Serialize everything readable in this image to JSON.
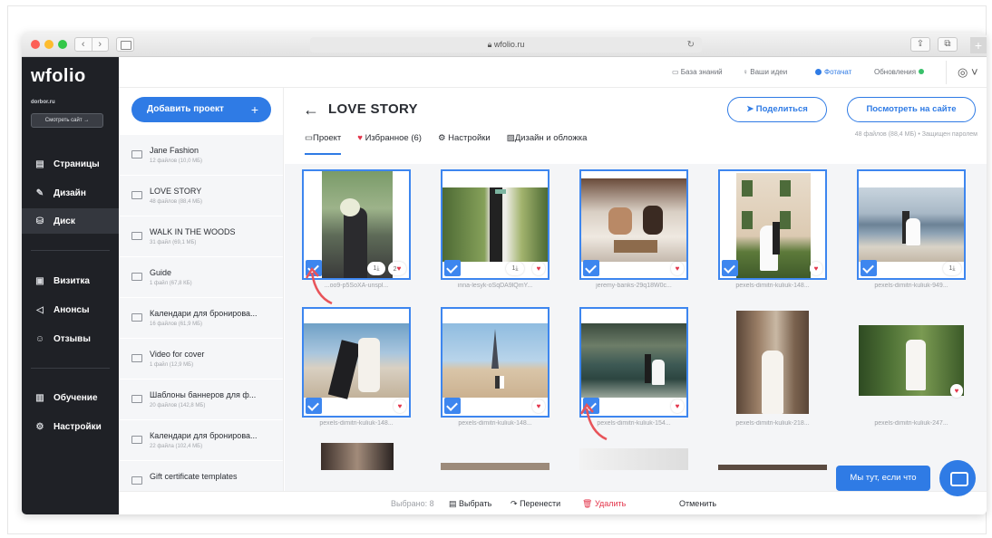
{
  "browser": {
    "url": "wfolio.ru",
    "lock_icon": "lock-icon"
  },
  "sidebar": {
    "logo": "wfolio",
    "domain": "dorbor.ru",
    "view_site": "Смотреть сайт →",
    "items": [
      {
        "label": "Страницы",
        "icon": "pages-icon"
      },
      {
        "label": "Дизайн",
        "icon": "brush-icon"
      },
      {
        "label": "Диск",
        "icon": "disk-icon"
      },
      {
        "label": "Визитка",
        "icon": "card-icon"
      },
      {
        "label": "Анонсы",
        "icon": "megaphone-icon"
      },
      {
        "label": "Отзывы",
        "icon": "reviews-icon"
      },
      {
        "label": "Обучение",
        "icon": "book-icon"
      },
      {
        "label": "Настройки",
        "icon": "gear-icon"
      }
    ]
  },
  "header": {
    "knowledge": "База знаний",
    "ideas": "Ваши идеи",
    "photochat": "Фотачат",
    "updates": "Обновления"
  },
  "projects": {
    "add_label": "Добавить проект",
    "add_plus": "+",
    "list": [
      {
        "name": "Jane Fashion",
        "meta": "12 файлов (10,0 МБ)"
      },
      {
        "name": "LOVE STORY",
        "meta": "48 файлов (88,4 МБ)"
      },
      {
        "name": "WALK IN THE WOODS",
        "meta": "31 файл (69,1 МБ)"
      },
      {
        "name": "Guide",
        "meta": "1 файл (67,8 КБ)"
      },
      {
        "name": "Календари для бронирова...",
        "meta": "16 файлов (61,9 МБ)"
      },
      {
        "name": "Video for cover",
        "meta": "1 файл (12,9 МБ)"
      },
      {
        "name": "Шаблоны баннеров для ф...",
        "meta": "20 файлов (142,8 МБ)"
      },
      {
        "name": "Календари для бронирова...",
        "meta": "22 файла (102,4 МБ)"
      },
      {
        "name": "Gift certificate templates",
        "meta": ""
      }
    ]
  },
  "main": {
    "back_arrow": "←",
    "title": "LOVE STORY",
    "share": "Поделиться",
    "view_on_site": "Посмотреть на сайте",
    "tabs": [
      "Проект",
      "Избранное (6)",
      "Настройки",
      "Дизайн и обложка"
    ],
    "files_info": "48 файлов (88,4 МБ) • Защищен паролем"
  },
  "photos": [
    {
      "file": "...oo9-p5SoXA-unspl...",
      "selected": true,
      "downloads": "1",
      "likes": "2"
    },
    {
      "file": "inna-lesyk-oSqDA9lQmY...",
      "selected": true,
      "downloads": "1",
      "likes": ""
    },
    {
      "file": "jeremy-banks-29q18W0c...",
      "selected": true,
      "downloads": "",
      "likes": ""
    },
    {
      "file": "pexels-dimitri-kuliuk-148...",
      "selected": true,
      "downloads": "",
      "likes": ""
    },
    {
      "file": "pexels-dimitri-kuliuk-949...",
      "selected": true,
      "downloads": "1",
      "likes": ""
    },
    {
      "file": "pexels-dimitri-kuliuk-148...",
      "selected": true,
      "downloads": "",
      "likes": ""
    },
    {
      "file": "pexels-dimitri-kuliuk-148...",
      "selected": true,
      "downloads": "",
      "likes": ""
    },
    {
      "file": "pexels-dimitri-kuliuk-154...",
      "selected": true,
      "downloads": "",
      "likes": ""
    },
    {
      "file": "pexels-dimitri-kuliuk-218...",
      "selected": false,
      "downloads": "",
      "likes": ""
    },
    {
      "file": "pexels-dimitri-kuliuk-247...",
      "selected": false,
      "downloads": "",
      "likes": ""
    }
  ],
  "bottom": {
    "selected": "Выбрано: 8",
    "choose": "Выбрать",
    "move": "Перенести",
    "delete": "Удалить",
    "cancel": "Отменить"
  },
  "chat": {
    "label": "Мы тут, если что"
  },
  "colors": {
    "accent": "#2f7be5",
    "sidebar_bg": "#1f2126",
    "heart": "#e3344a",
    "online": "#39c06a"
  }
}
